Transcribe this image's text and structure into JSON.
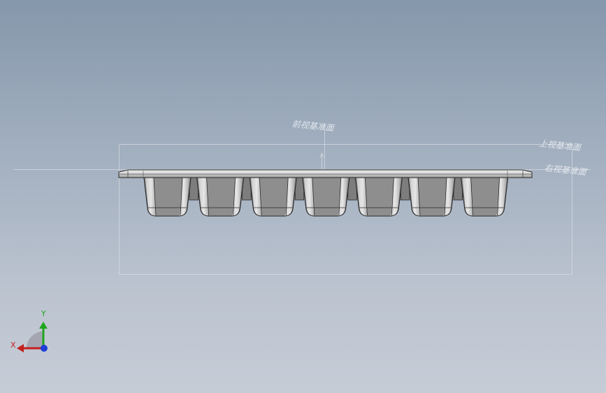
{
  "scene": {
    "plane_labels": {
      "front": "前视基准面",
      "top": "上视基准面",
      "right": "右视基准面"
    },
    "pocket_count": 7
  },
  "triad": {
    "x_label": "X",
    "y_label": "Y",
    "colors": {
      "x": "#c41f1f",
      "y": "#1fa51f",
      "z": "#1f3fd6"
    }
  },
  "colors": {
    "part_fill": "#8e8e8e",
    "part_edge": "#2a2a2a",
    "plane_line": "#d9dde4"
  }
}
